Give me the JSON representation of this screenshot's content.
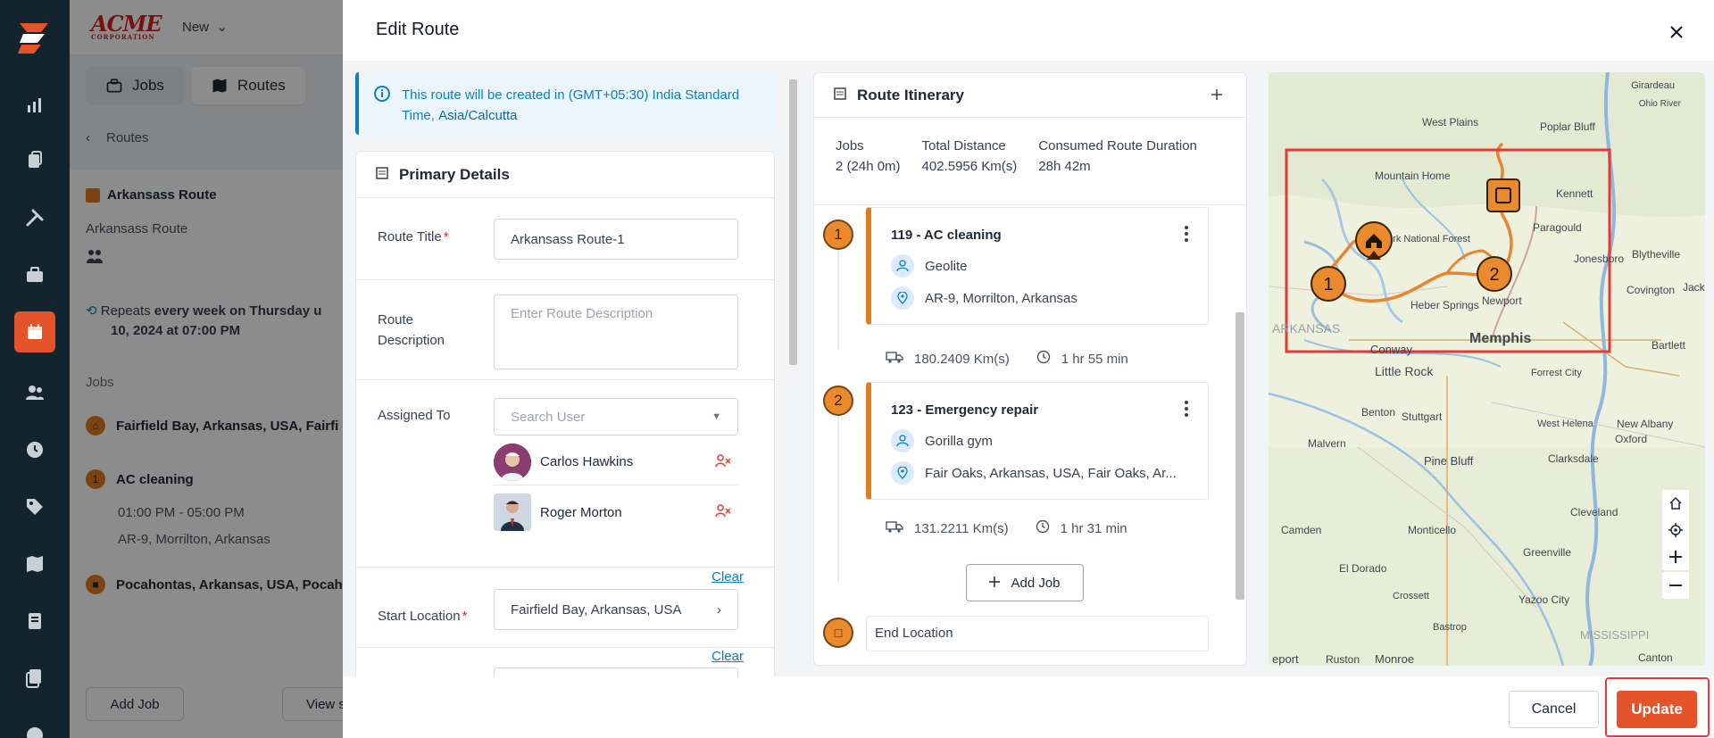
{
  "app": {
    "brand": "ACME",
    "brand_sub": "CORPORATION",
    "new_menu": "New"
  },
  "background": {
    "tabs": [
      {
        "label": "Jobs"
      },
      {
        "label": "Routes"
      }
    ],
    "breadcrumb": "Routes",
    "route_name": "Arkansass Route",
    "route_sub": "Arkansass Route",
    "repeats_prefix": "Repeats",
    "repeats_bold_line1": "every week on Thursday u",
    "repeats_bold_line2": "10, 2024 at 07:00 PM",
    "jobs_label": "Jobs",
    "job_rows": [
      {
        "pin": "",
        "title": "Fairfield Bay, Arkansas, USA, Fairfi"
      },
      {
        "pin": "1",
        "title": "AC cleaning",
        "time": "01:00 PM - 05:00 PM",
        "address": "AR-9, Morrilton, Arkansas"
      },
      {
        "pin": "",
        "title": "Pocahontas, Arkansas, USA, Pocah"
      }
    ],
    "add_job_button": "Add Job",
    "view_button": "View s"
  },
  "modal": {
    "title": "Edit Route",
    "info": {
      "text": "This route will be created in (GMT+05:30) India Standard Time,",
      "timezone": "Asia/Calcutta"
    },
    "primary_details": {
      "heading": "Primary Details",
      "route_title_label": "Route Title",
      "route_title_value": "Arkansass Route-1",
      "route_description_label": "Route Description",
      "route_description_placeholder": "Enter Route Description",
      "assigned_to_label": "Assigned To",
      "search_user_placeholder": "Search User",
      "users": [
        {
          "name": "Carlos Hawkins"
        },
        {
          "name": "Roger Morton"
        }
      ],
      "clear_label": "Clear",
      "start_location_label": "Start Location",
      "start_location_value": "Fairfield Bay, Arkansas, USA"
    },
    "itinerary": {
      "heading": "Route Itinerary",
      "stats": [
        {
          "label": "Jobs",
          "value": "2 (24h 0m)"
        },
        {
          "label": "Total Distance",
          "value": "402.5956 Km(s)"
        },
        {
          "label": "Consumed Route Duration",
          "value": "28h 42m"
        }
      ],
      "jobs": [
        {
          "pin": "1",
          "title": "119 - AC cleaning",
          "customer": "Geolite",
          "address": "AR-9, Morrilton, Arkansas",
          "distance": "180.2409 Km(s)",
          "duration": "1 hr 55 min"
        },
        {
          "pin": "2",
          "title": "123 - Emergency repair",
          "customer": "Gorilla gym",
          "address": "Fair Oaks, Arkansas, USA, Fair Oaks, Ar...",
          "distance": "131.2211 Km(s)",
          "duration": "1 hr 31 min"
        }
      ],
      "add_job_label": "Add Job",
      "end_location_label": "End Location"
    },
    "map": {
      "labels": [
        {
          "text": "Girardeau"
        },
        {
          "text": "Ohio River"
        },
        {
          "text": "West Plains"
        },
        {
          "text": "Poplar Bluff"
        },
        {
          "text": "Mountain Home"
        },
        {
          "text": "Kennett"
        },
        {
          "text": "Ozark National Forest"
        },
        {
          "text": "Paragould"
        },
        {
          "text": "Blytheville"
        },
        {
          "text": "Jonesboro"
        },
        {
          "text": "Heber Springs"
        },
        {
          "text": "Newport"
        },
        {
          "text": "Covington"
        },
        {
          "text": "Jackso"
        },
        {
          "text": "ARKANSAS"
        },
        {
          "text": "Conway"
        },
        {
          "text": "Memphis"
        },
        {
          "text": "Bartlett"
        },
        {
          "text": "Little Rock"
        },
        {
          "text": "Forrest City"
        },
        {
          "text": "Benton"
        },
        {
          "text": "Stuttgart"
        },
        {
          "text": "West Helena"
        },
        {
          "text": "New Albany"
        },
        {
          "text": "Malvern"
        },
        {
          "text": "Pine Bluff"
        },
        {
          "text": "Clarksdale"
        },
        {
          "text": "Oxford"
        },
        {
          "text": "Camden"
        },
        {
          "text": "Monticello"
        },
        {
          "text": "Cleveland"
        },
        {
          "text": "Greenville"
        },
        {
          "text": "El Dorado"
        },
        {
          "text": "Crossett"
        },
        {
          "text": "Yazoo City"
        },
        {
          "text": "Bastrop"
        },
        {
          "text": "MISSISSIPPI"
        },
        {
          "text": "eport"
        },
        {
          "text": "Ruston"
        },
        {
          "text": "Monroe"
        },
        {
          "text": "Canton"
        }
      ],
      "markers": [
        {
          "label": "1"
        },
        {
          "label": "2"
        }
      ],
      "colors": {
        "route": "#e9852f",
        "highlight": "#e53935"
      }
    },
    "footer": {
      "cancel_label": "Cancel",
      "update_label": "Update"
    }
  },
  "colors": {
    "accent": "#e4532a",
    "route": "#e07b1f",
    "link": "#0b7fc4",
    "nav": "#14242f"
  }
}
